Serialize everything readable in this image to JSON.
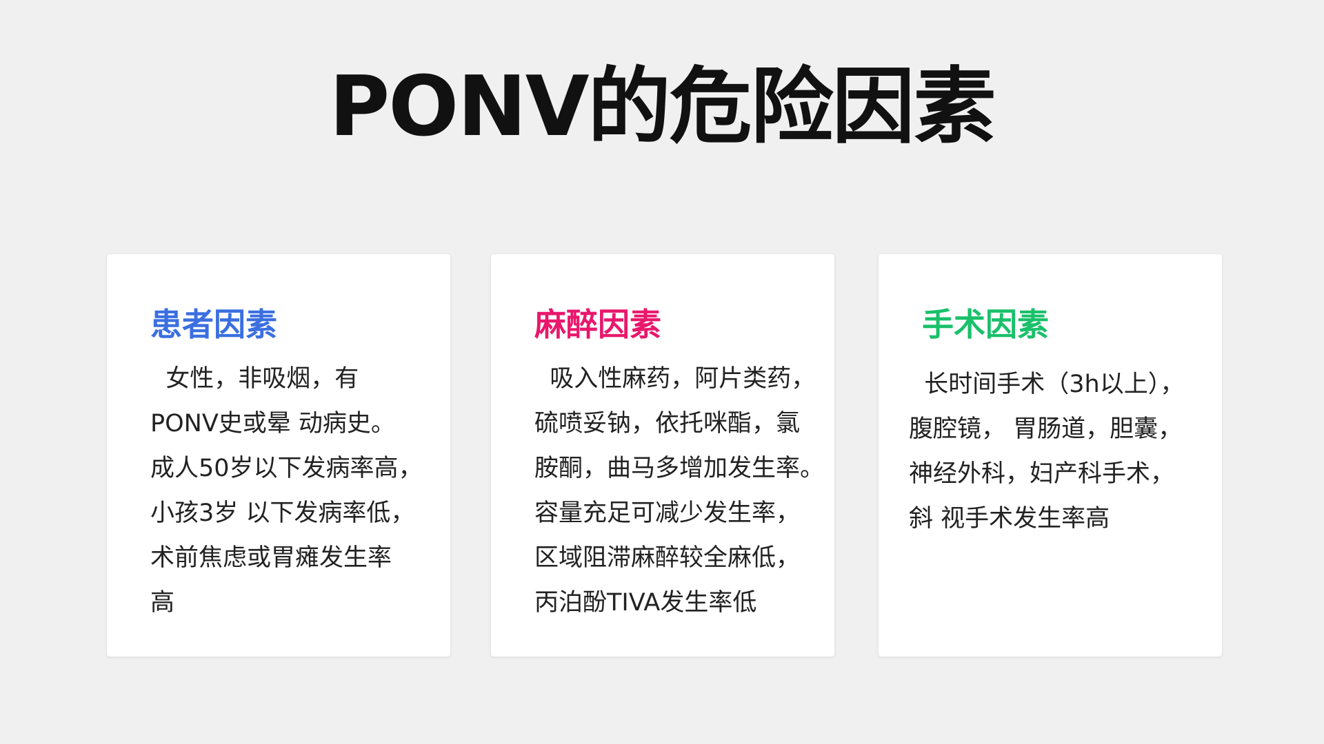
{
  "title": "PONV的危险因素",
  "cards": [
    {
      "heading": "患者因素",
      "heading_color": "#3b6fe0",
      "body": "  女性，非吸烟，有\nPONV史或晕 动病史。\n成人50岁以下发病率高，\n小孩3岁 以下发病率低，\n术前焦虑或胃瘫发生率\n高"
    },
    {
      "heading": "麻醉因素",
      "heading_color": "#e8186c",
      "body": "  吸入性麻药，阿片类药，\n硫喷妥钠，依托咪酯，氯\n胺酮，曲马多增加发生率。\n容量充足可减少发生率，\n区域阻滞麻醉较全麻低，\n丙泊酚TIVA发生率低"
    },
    {
      "heading": "手术因素",
      "heading_color": "#1ac06a",
      "body": "  长时间手术（3h以上），\n腹腔镜， 胃肠道，胆囊，\n神经外科，妇产科手术，\n斜 视手术发生率高"
    }
  ]
}
